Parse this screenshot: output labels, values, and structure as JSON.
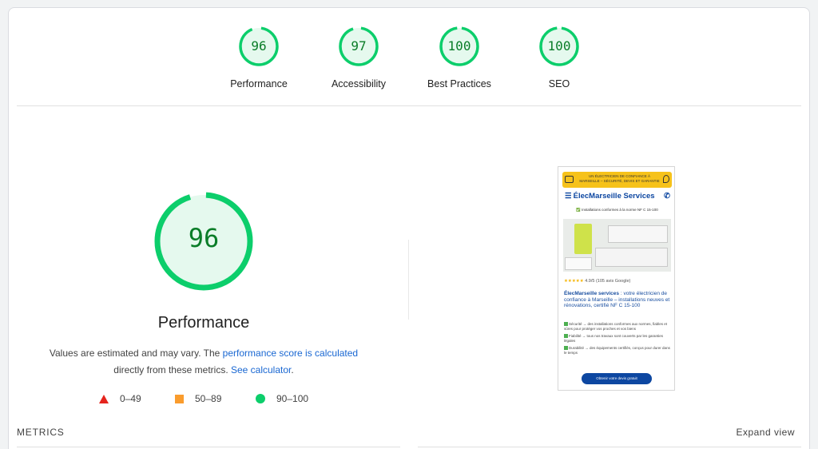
{
  "scores": [
    {
      "label": "Performance",
      "value": "96",
      "fraction": 0.96
    },
    {
      "label": "Accessibility",
      "value": "97",
      "fraction": 0.97
    },
    {
      "label": "Best Practices",
      "value": "100",
      "fraction": 1.0
    },
    {
      "label": "SEO",
      "value": "100",
      "fraction": 1.0
    }
  ],
  "main": {
    "score": "96",
    "fraction": 0.96,
    "title": "Performance",
    "desc_before": "Values are estimated and may vary. The ",
    "desc_link1": "performance score is calculated",
    "desc_middle": " directly from these metrics. ",
    "desc_link2": "See calculator",
    "desc_after": "."
  },
  "legend": [
    {
      "icon": "red-triangle",
      "label": "0–49"
    },
    {
      "icon": "orange-square",
      "label": "50–89"
    },
    {
      "icon": "green-circle",
      "label": "90–100"
    }
  ],
  "colors": {
    "pass": "#0cce6b",
    "pass_text": "#0a7d28",
    "pass_bg": "#e5f9ee",
    "average": "#fa9c2d",
    "fail": "#e5241d",
    "link": "#1967d2"
  },
  "screenshot": {
    "topbar_text": "UN ÉLECTRICIEN DE CONFIANCE À MARSEILLE – SÉCURITÉ, DEVIS ET GARANTIE",
    "brand": "ÉlecMarseille Services",
    "conformity": "✅ Installations conformes à la norme NF C 15-100",
    "stars": "★★★★★",
    "rating": "4.9/5 (105 avis Google)",
    "headline_bold": "ÉlecMarseille services",
    "headline_rest": " : votre électricien de confiance à Marseille – installations neuves et rénovations, certifié NF C 15-100",
    "items": [
      "Sécurité → des installations conformes aux normes, fiables et sûres pour protéger vos proches et vos biens",
      "Fiabilité → tous nos travaux sont couverts par les garanties légales",
      "Durabilité → des équipements certifiés, conçus pour durer dans le temps"
    ],
    "button": "Obtenir votre devis gratuit"
  },
  "footer": {
    "metrics_label": "METRICS",
    "expand_label": "Expand view"
  }
}
